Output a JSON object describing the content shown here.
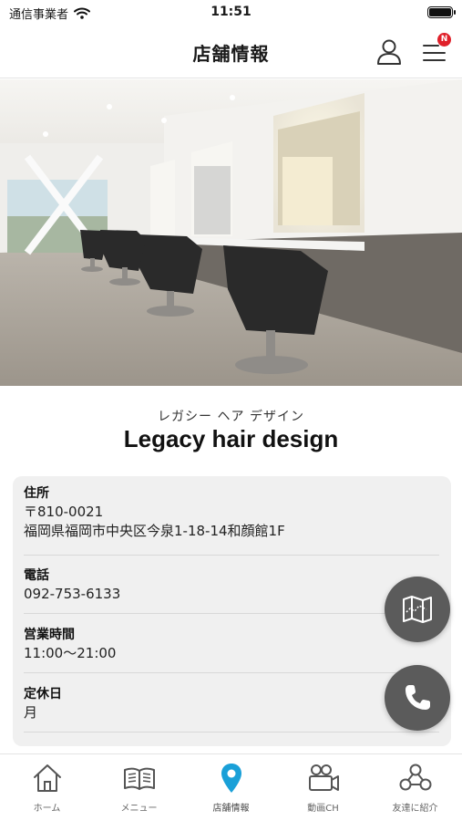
{
  "status_bar": {
    "carrier": "通信事業者",
    "time": "11:51"
  },
  "header": {
    "title": "店舗情報",
    "badge": "N"
  },
  "shop": {
    "name_kana": "レガシー ヘア デザイン",
    "name": "Legacy hair design"
  },
  "info": [
    {
      "label": "住所",
      "lines": [
        "〒810-0021",
        "福岡県福岡市中央区今泉1-18-14和顔館1F"
      ]
    },
    {
      "label": "電話",
      "lines": [
        "092-753-6133"
      ]
    },
    {
      "label": "営業時間",
      "lines": [
        "11:00〜21:00"
      ]
    },
    {
      "label": "定休日",
      "lines": [
        "月"
      ]
    }
  ],
  "tabs": [
    {
      "label": "ホーム",
      "icon": "home-icon",
      "active": false
    },
    {
      "label": "メニュー",
      "icon": "book-icon",
      "active": false
    },
    {
      "label": "店舗情報",
      "icon": "location-pin-icon",
      "active": true
    },
    {
      "label": "動画CH",
      "icon": "video-camera-icon",
      "active": false
    },
    {
      "label": "友達に紹介",
      "icon": "share-friends-icon",
      "active": false
    }
  ],
  "colors": {
    "accent": "#1aa0d8",
    "fab": "#5b5b5b",
    "badge": "#e0202a",
    "card_bg": "#f0f0f0"
  }
}
